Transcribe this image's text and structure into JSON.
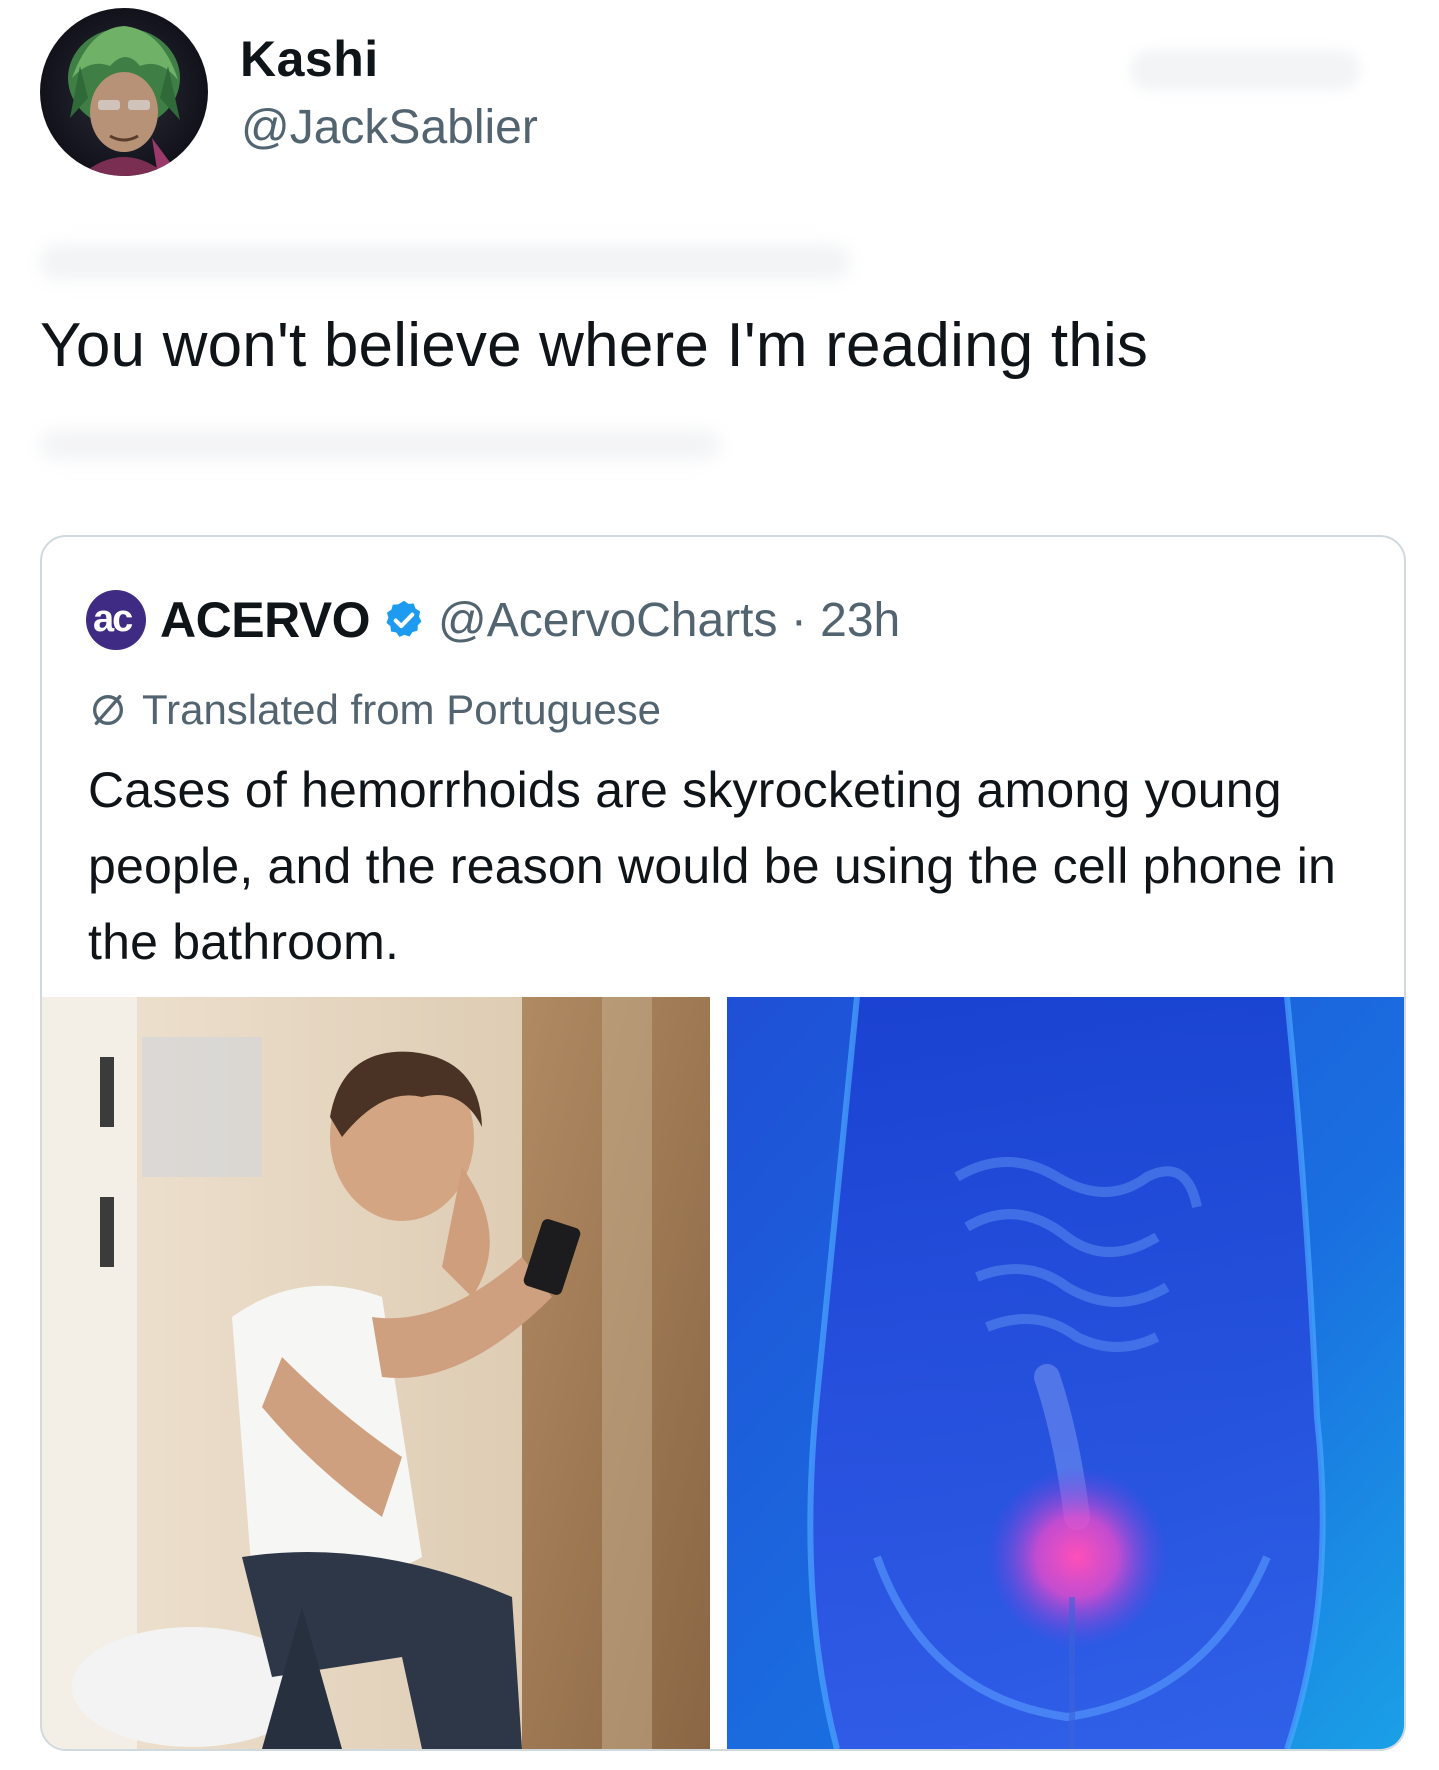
{
  "tweet": {
    "author_name": "Kashi",
    "author_handle": "@JackSablier",
    "text": "You won't believe where I'm reading this"
  },
  "quote": {
    "logo_text": "ac",
    "name": "ACERVO",
    "handle_time": "@AcervoCharts · 23h",
    "translated_label": "Translated from Portuguese",
    "text": "Cases of hemorrhoids are skyrocketing among young people, and the reason would be using the cell phone in the bathroom."
  },
  "icons": {
    "verified": "verified-badge-icon",
    "translate": "translate-icon"
  },
  "colors": {
    "text": "#0f1419",
    "secondary": "#536471",
    "border": "#cfd9de",
    "verified_blue": "#1d9bf0",
    "acervo_purple": "#3f2a84"
  }
}
